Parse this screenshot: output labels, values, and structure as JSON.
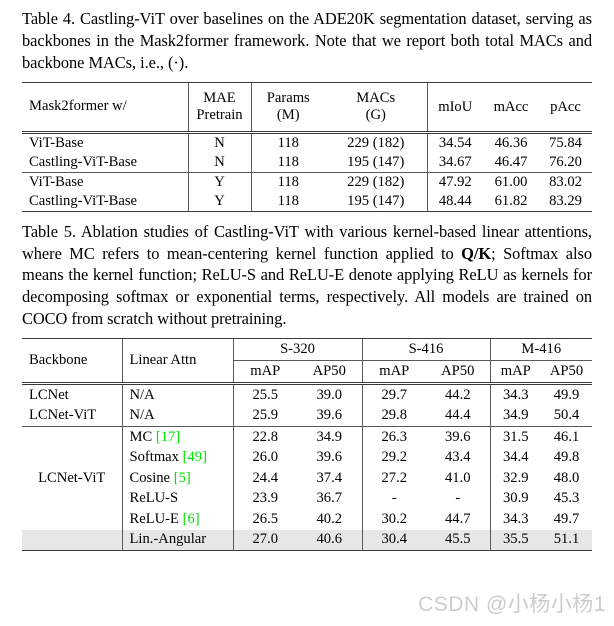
{
  "table4": {
    "caption_label": "Table 4.",
    "caption_text": " Castling-ViT over baselines on the ADE20K segmentation dataset, serving as backbones in the Mask2former framework. Note that we report both total MACs and backbone MACs, i.e., (·).",
    "headers": {
      "backbone": "Mask2former w/",
      "pretrain_l1": "MAE",
      "pretrain_l2": "Pretrain",
      "params_l1": "Params",
      "params_l2": "(M)",
      "macs_l1": "MACs",
      "macs_l2": "(G)",
      "miou": "mIoU",
      "macc": "mAcc",
      "pacc": "pAcc"
    },
    "rows": [
      {
        "backbone": "ViT-Base",
        "pretrain": "N",
        "params": "118",
        "macs": "229 (182)",
        "miou": "34.54",
        "macc": "46.36",
        "pacc": "75.84",
        "bold": false,
        "group_start": true
      },
      {
        "backbone": "Castling-ViT-Base",
        "pretrain": "N",
        "params": "118",
        "macs": "195 (147)",
        "miou": "34.67",
        "macc": "46.47",
        "pacc": "76.20",
        "bold": true,
        "group_start": false
      },
      {
        "backbone": "ViT-Base",
        "pretrain": "Y",
        "params": "118",
        "macs": "229 (182)",
        "miou": "47.92",
        "macc": "61.00",
        "pacc": "83.02",
        "bold": false,
        "group_start": true
      },
      {
        "backbone": "Castling-ViT-Base",
        "pretrain": "Y",
        "params": "118",
        "macs": "195 (147)",
        "miou": "48.44",
        "macc": "61.82",
        "pacc": "83.29",
        "bold": true,
        "group_start": false
      }
    ]
  },
  "table5": {
    "caption_label": "Table 5.",
    "caption_pre": " Ablation studies of Castling-ViT with various kernel-based linear attentions, where MC refers to mean-centering kernel function applied to ",
    "caption_math": "Q/K",
    "caption_post": "; Softmax also means the kernel function; ReLU-S and ReLU-E denote applying ReLU as kernels for decomposing softmax or exponential terms, respectively. All models are trained on COCO from scratch without pretraining.",
    "headers": {
      "backbone": "Backbone",
      "linear_attn": "Linear Attn",
      "g1": "S-320",
      "g2": "S-416",
      "g3": "M-416",
      "map": "mAP",
      "ap50": "AP50"
    },
    "rows": [
      {
        "backbone": "LCNet",
        "attn": "N/A",
        "cite": "",
        "s320_map": "25.5",
        "s320_ap50": "39.0",
        "s416_map": "29.7",
        "s416_ap50": "44.2",
        "m416_map": "34.3",
        "m416_ap50": "49.9",
        "bold": false,
        "hl": false
      },
      {
        "backbone": "LCNet-ViT",
        "attn": "N/A",
        "cite": "",
        "s320_map": "25.9",
        "s320_ap50": "39.6",
        "s416_map": "29.8",
        "s416_ap50": "44.4",
        "m416_map": "34.9",
        "m416_ap50": "50.4",
        "bold": false,
        "hl": false
      },
      {
        "backbone": "",
        "attn": "MC",
        "cite": "[17]",
        "s320_map": "22.8",
        "s320_ap50": "34.9",
        "s416_map": "26.3",
        "s416_ap50": "39.6",
        "m416_map": "31.5",
        "m416_ap50": "46.1",
        "bold": false,
        "hl": false
      },
      {
        "backbone": "",
        "attn": "Softmax",
        "cite": "[49]",
        "s320_map": "26.0",
        "s320_ap50": "39.6",
        "s416_map": "29.2",
        "s416_ap50": "43.4",
        "m416_map": "34.4",
        "m416_ap50": "49.8",
        "bold": false,
        "hl": false
      },
      {
        "backbone": "LCNet-ViT",
        "attn": "Cosine",
        "cite": "[5]",
        "s320_map": "24.4",
        "s320_ap50": "37.4",
        "s416_map": "27.2",
        "s416_ap50": "41.0",
        "m416_map": "32.9",
        "m416_ap50": "48.0",
        "bold": false,
        "hl": false
      },
      {
        "backbone": "",
        "attn": "ReLU-S",
        "cite": "",
        "s320_map": "23.9",
        "s320_ap50": "36.7",
        "s416_map": "-",
        "s416_ap50": "-",
        "m416_map": "30.9",
        "m416_ap50": "45.3",
        "bold": false,
        "hl": false
      },
      {
        "backbone": "",
        "attn": "ReLU-E",
        "cite": "[6]",
        "s320_map": "26.5",
        "s320_ap50": "40.2",
        "s416_map": "30.2",
        "s416_ap50": "44.7",
        "m416_map": "34.3",
        "m416_ap50": "49.7",
        "bold": false,
        "hl": false
      },
      {
        "backbone": "",
        "attn": "Lin.-Angular",
        "cite": "",
        "s320_map": "27.0",
        "s320_ap50": "40.6",
        "s416_map": "30.4",
        "s416_ap50": "45.5",
        "m416_map": "35.5",
        "m416_ap50": "51.1",
        "bold": true,
        "hl": true
      }
    ]
  },
  "watermark": {
    "text": "CSDN @小杨小杨1"
  },
  "colors": {
    "citation_green": "#00e000",
    "highlight_row": "#e7e7e7",
    "rule": "#3a3a3a"
  }
}
